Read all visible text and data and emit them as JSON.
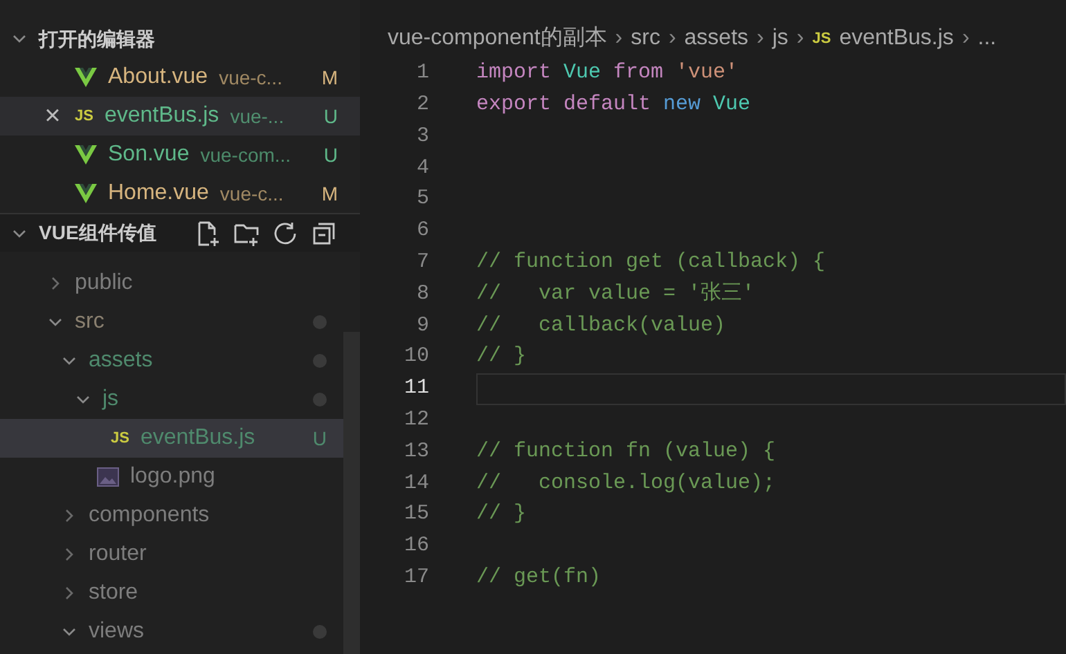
{
  "open_editors": {
    "title": "打开的编辑器",
    "expanded": true,
    "items": [
      {
        "kind": "vue",
        "name": "About.vue",
        "path": "vue-c...",
        "badge": "M",
        "color": "#d7b57f",
        "selected": false
      },
      {
        "kind": "js",
        "icon_text": "JS",
        "name": "eventBus.js",
        "path": "vue-...",
        "badge": "U",
        "color": "#5fb98a",
        "selected": true,
        "close": "×"
      },
      {
        "kind": "vue",
        "name": "Son.vue",
        "path": "vue-com...",
        "badge": "U",
        "color": "#5fb98a",
        "selected": false
      },
      {
        "kind": "vue",
        "name": "Home.vue",
        "path": "vue-c...",
        "badge": "M",
        "color": "#d7b57f",
        "selected": false
      }
    ]
  },
  "workspace": {
    "title": "VUE组件传值",
    "expanded": true,
    "tree": [
      {
        "name": "public",
        "kind": "folder",
        "expanded": false,
        "color": "#7d7d7d"
      },
      {
        "name": "src",
        "kind": "folder",
        "expanded": true,
        "color": "#8a8070",
        "dot": true,
        "children": [
          {
            "name": "assets",
            "kind": "folder",
            "expanded": true,
            "color": "#4f8a6d",
            "dot": true,
            "children": [
              {
                "name": "js",
                "kind": "folder",
                "expanded": true,
                "color": "#4f8a6d",
                "dot": true,
                "children": [
                  {
                    "name": "eventBus.js",
                    "kind": "js",
                    "icon_text": "JS",
                    "color": "#4f8a6d",
                    "badge": "U",
                    "selected": true
                  }
                ]
              },
              {
                "name": "logo.png",
                "kind": "image",
                "color": "#7d7d7d"
              }
            ]
          },
          {
            "name": "components",
            "kind": "folder",
            "expanded": false,
            "color": "#7d7d7d"
          },
          {
            "name": "router",
            "kind": "folder",
            "expanded": false,
            "color": "#7d7d7d"
          },
          {
            "name": "store",
            "kind": "folder",
            "expanded": false,
            "color": "#7d7d7d"
          },
          {
            "name": "views",
            "kind": "folder",
            "expanded": true,
            "color": "#7d7d7d",
            "dot": true
          }
        ]
      }
    ]
  },
  "breadcrumb": [
    {
      "text": "vue-component的副本"
    },
    {
      "separator": "›",
      "text": "src"
    },
    {
      "separator": "›",
      "text": "assets"
    },
    {
      "separator": "›",
      "text": "js"
    },
    {
      "separator": "›",
      "icon_text": "JS",
      "text": "eventBus.js"
    },
    {
      "separator": "›",
      "text": "..."
    }
  ],
  "code": [
    {
      "number": "1",
      "tokens": [
        {
          "kind": "keyword",
          "text": "import "
        },
        {
          "kind": "class",
          "text": "Vue"
        },
        {
          "kind": "keyword",
          "text": " from "
        },
        {
          "kind": "string",
          "text": "'vue'"
        }
      ]
    },
    {
      "number": "2",
      "tokens": [
        {
          "kind": "keyword",
          "text": "export default "
        },
        {
          "kind": "new",
          "text": "new "
        },
        {
          "kind": "class",
          "text": "Vue"
        }
      ]
    },
    {
      "number": "3"
    },
    {
      "number": "4"
    },
    {
      "number": "5"
    },
    {
      "number": "6"
    },
    {
      "number": "7",
      "tokens": [
        {
          "kind": "comment",
          "text": "// function get (callback) {"
        }
      ]
    },
    {
      "number": "8",
      "tokens": [
        {
          "kind": "comment",
          "text": "//   var value = '张三'"
        }
      ]
    },
    {
      "number": "9",
      "tokens": [
        {
          "kind": "comment",
          "text": "//   callback(value)"
        }
      ]
    },
    {
      "number": "10",
      "tokens": [
        {
          "kind": "comment",
          "text": "// }"
        }
      ]
    },
    {
      "number": "11",
      "current": true
    },
    {
      "number": "12"
    },
    {
      "number": "13",
      "tokens": [
        {
          "kind": "comment",
          "text": "// function fn (value) {"
        }
      ]
    },
    {
      "number": "14",
      "tokens": [
        {
          "kind": "comment",
          "text": "//   console.log(value);"
        }
      ]
    },
    {
      "number": "15",
      "tokens": [
        {
          "kind": "comment",
          "text": "// }"
        }
      ]
    },
    {
      "number": "16"
    },
    {
      "number": "17",
      "tokens": [
        {
          "kind": "comment",
          "text": "// get(fn)"
        }
      ]
    }
  ]
}
